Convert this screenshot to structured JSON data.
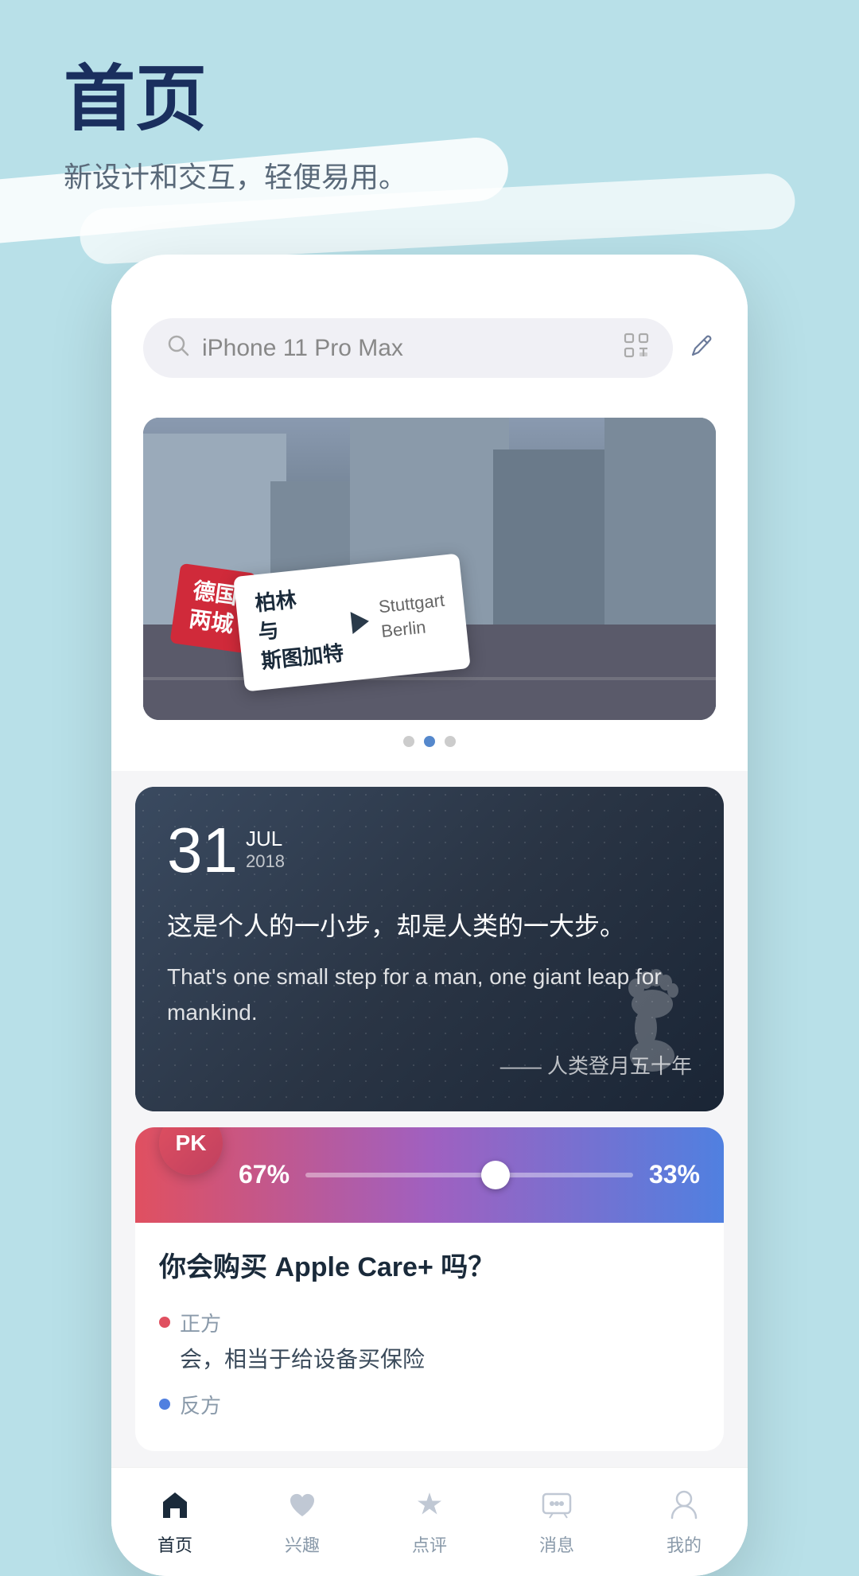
{
  "page": {
    "background_color": "#b8e0e8",
    "title": "首页",
    "subtitle": "新设计和交互，轻便易用。"
  },
  "search": {
    "placeholder": "iPhone 11 Pro Max",
    "icon": "search-icon",
    "scan_icon": "scan-icon",
    "edit_icon": "edit-icon"
  },
  "banner": {
    "overlay_text_line1": "柏林",
    "overlay_text_line2": "与",
    "overlay_text_line3": "斯图加特",
    "pink_card_text": "德国\n两城",
    "sub_text": "Stuttgart\nBerlin",
    "dots": [
      {
        "active": false
      },
      {
        "active": true
      },
      {
        "active": false
      }
    ]
  },
  "quote_card": {
    "day": "31",
    "month": "JUL",
    "year": "2018",
    "text_zh": "这是个人的一小步，却是人类的一大步。",
    "text_en": "That's one small step for a man, one giant leap for mankind.",
    "source": "—— 人类登月五十年"
  },
  "pk_card": {
    "badge": "PK",
    "percent_left": "67%",
    "percent_right": "33%",
    "question": "你会购买 Apple Care+ 吗？",
    "option_pro_label": "正方",
    "option_pro_content": "会，相当于给设备买保险",
    "option_con_label": "反方"
  },
  "bottom_nav": {
    "items": [
      {
        "label": "首页",
        "icon": "home-icon",
        "active": true
      },
      {
        "label": "兴趣",
        "icon": "heart-icon",
        "active": false
      },
      {
        "label": "点评",
        "icon": "star-icon",
        "active": false
      },
      {
        "label": "消息",
        "icon": "message-icon",
        "active": false
      },
      {
        "label": "我的",
        "icon": "user-icon",
        "active": false
      }
    ]
  }
}
